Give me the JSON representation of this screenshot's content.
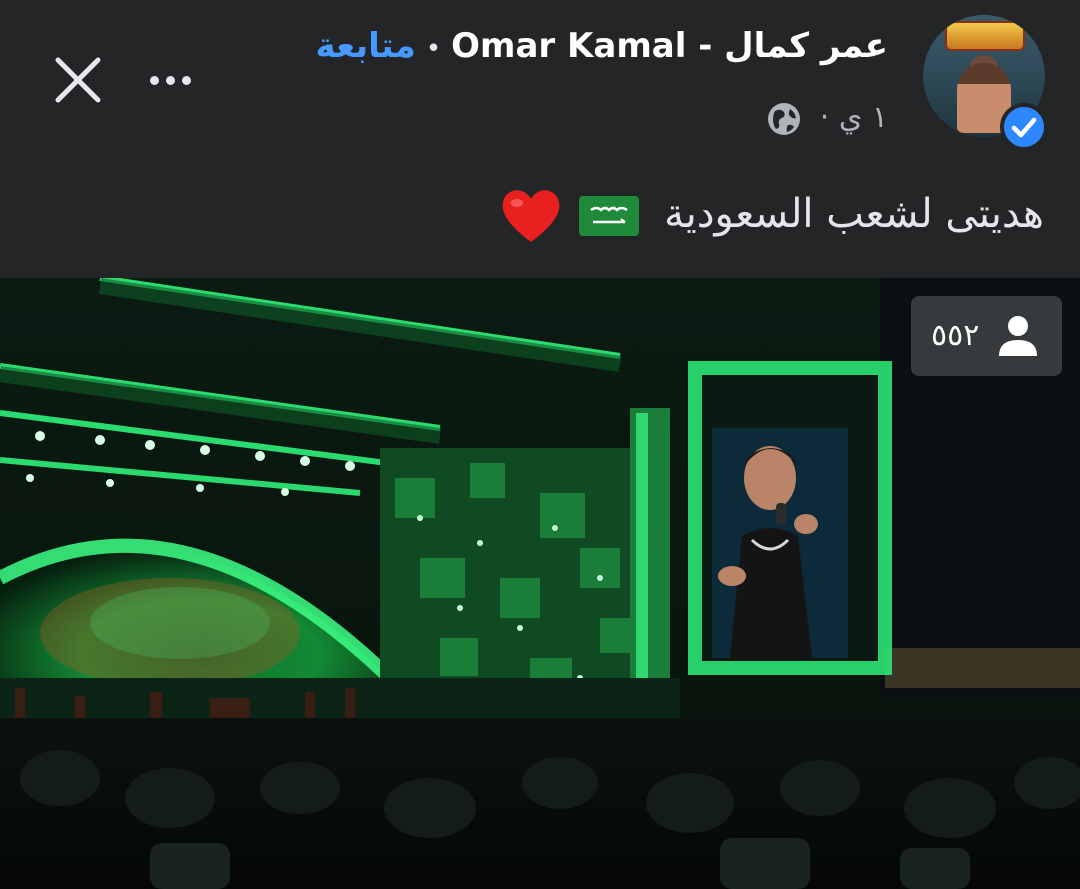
{
  "post": {
    "page_name": "عمر كمال - Omar Kamal",
    "separator": "•",
    "follow_label": "متابعة",
    "time": "١ ي",
    "time_separator": "·",
    "privacy_icon": "globe-icon",
    "verified_icon": "verified-check-icon",
    "caption_text": "هديتى لشعب السعودية",
    "caption_emojis": [
      "saudi-flag",
      "red-heart"
    ]
  },
  "toolbar": {
    "close_icon": "close-icon",
    "more_icon": "more-options-icon"
  },
  "video": {
    "viewer_count": "٥٥٢",
    "viewer_icon": "person-icon"
  },
  "colors": {
    "background": "#242526",
    "link_blue": "#4599ff",
    "verified_blue": "#2d88ff",
    "stage_green": "#1fd46a"
  }
}
